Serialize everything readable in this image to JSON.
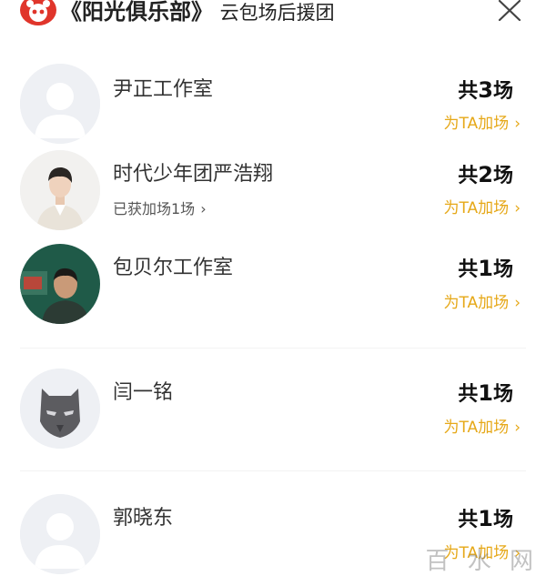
{
  "header": {
    "title": "《阳光俱乐部》",
    "subtitle": "云包场后援团",
    "close_icon": "close-icon",
    "logo_icon": "panda-logo-icon"
  },
  "colors": {
    "accent": "#e6a818",
    "logo": "#e0352b"
  },
  "rows": [
    {
      "name": "尹正工作室",
      "secondary": "",
      "count_prefix": "共",
      "count_value": "3",
      "count_suffix": "场",
      "boost_label": "为TA加场",
      "avatar": "default-avatar-icon"
    },
    {
      "name": "时代少年团严浩翔",
      "secondary": "已获加场1场",
      "count_prefix": "共",
      "count_value": "2",
      "count_suffix": "场",
      "boost_label": "为TA加场",
      "avatar": "photo-avatar"
    },
    {
      "name": "包贝尔工作室",
      "secondary": "",
      "count_prefix": "共",
      "count_value": "1",
      "count_suffix": "场",
      "boost_label": "为TA加场",
      "avatar": "photo-avatar"
    },
    {
      "name": "闫一铭",
      "secondary": "",
      "count_prefix": "共",
      "count_value": "1",
      "count_suffix": "场",
      "boost_label": "为TA加场",
      "avatar": "panther-mask-icon"
    },
    {
      "name": "郭晓东",
      "secondary": "",
      "count_prefix": "共",
      "count_value": "1",
      "count_suffix": "场",
      "boost_label": "为TA加场",
      "avatar": "default-avatar-icon"
    }
  ],
  "watermark": "百 水 网"
}
